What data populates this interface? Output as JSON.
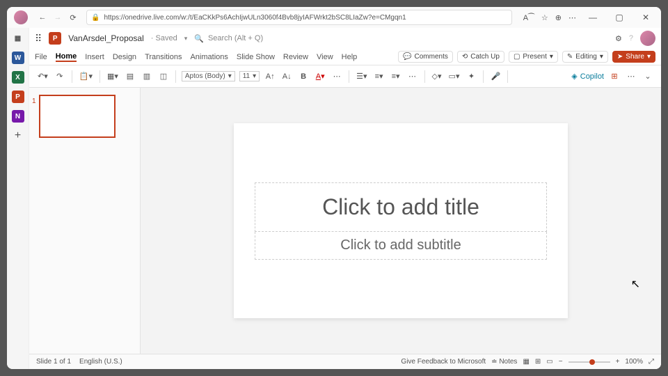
{
  "browser": {
    "url": "https://onedrive.live.com/w:/t/EaCKkPs6AchIjwULn3060f4Bvb8jyIAFWrkt2bSC8LIaZw?e=CMgqn1"
  },
  "header": {
    "doc_title": "VanArsdel_Proposal",
    "saved_label": "· Saved",
    "search_placeholder": "Search (Alt + Q)"
  },
  "tabs": {
    "file": "File",
    "home": "Home",
    "insert": "Insert",
    "design": "Design",
    "transitions": "Transitions",
    "animations": "Animations",
    "slideshow": "Slide Show",
    "review": "Review",
    "view": "View",
    "help": "Help",
    "comments": "Comments",
    "catchup": "Catch Up",
    "present": "Present",
    "editing": "Editing",
    "share": "Share"
  },
  "toolbar": {
    "font_name": "Aptos (Body)",
    "font_size": "11",
    "copilot": "Copilot"
  },
  "slide": {
    "title_placeholder": "Click to add title",
    "subtitle_placeholder": "Click to add subtitle",
    "thumb_number": "1"
  },
  "status": {
    "slide_info": "Slide 1 of 1",
    "language": "English (U.S.)",
    "feedback": "Give Feedback to Microsoft",
    "notes": "Notes",
    "zoom": "100%"
  }
}
